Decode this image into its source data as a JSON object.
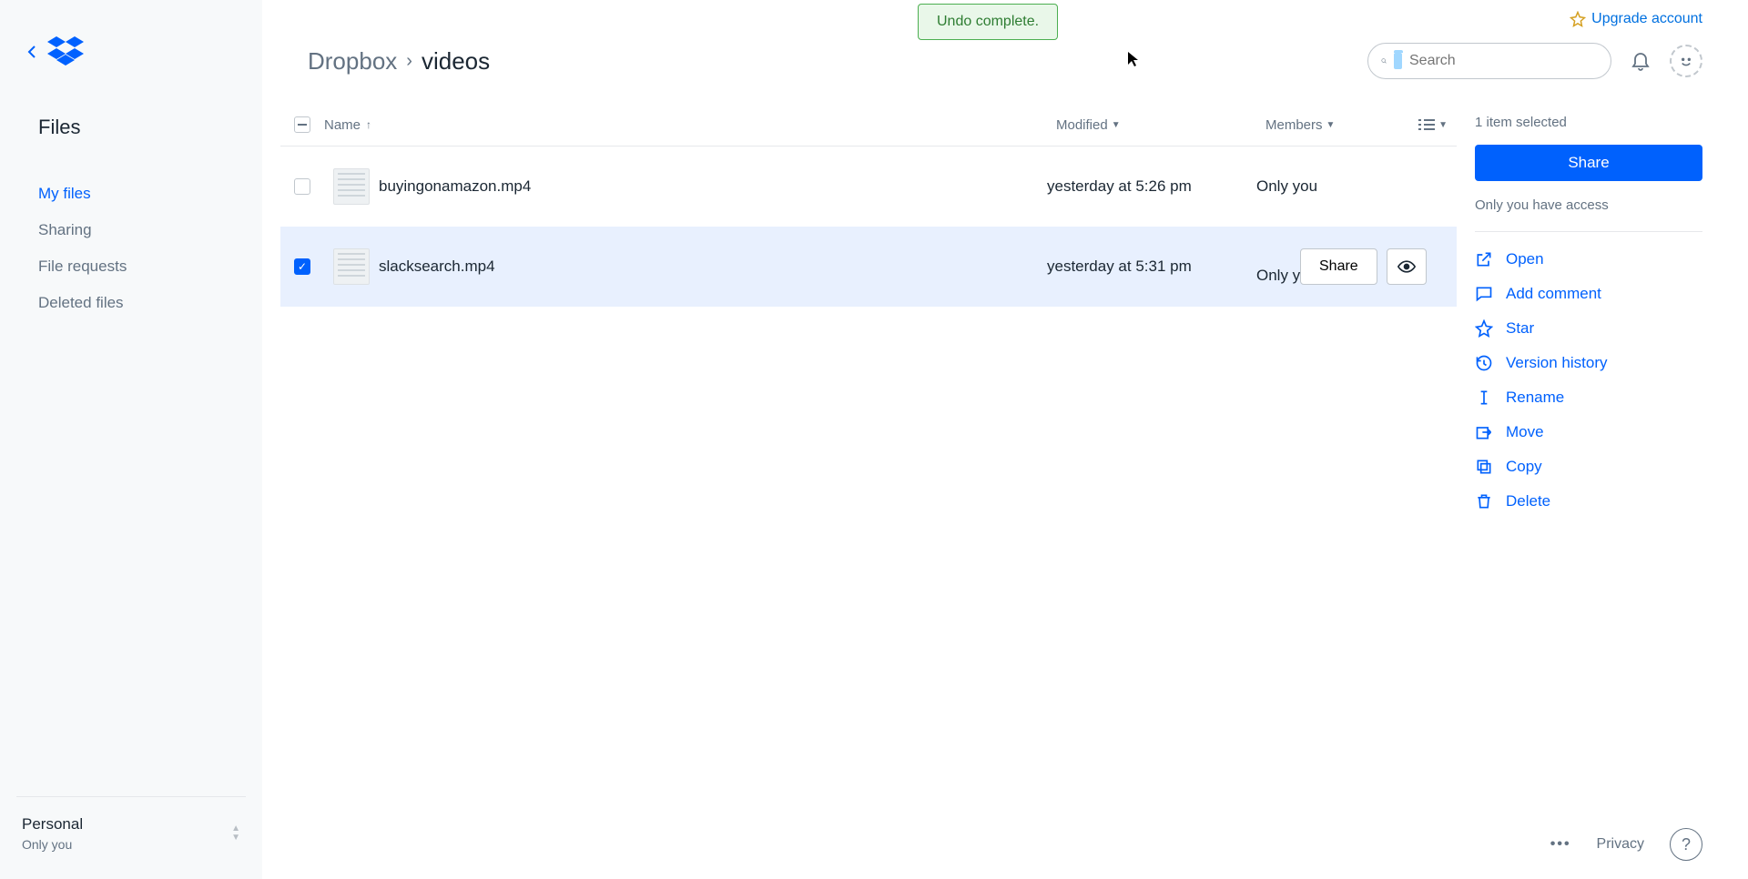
{
  "toast": "Undo complete.",
  "upgrade": {
    "label": "Upgrade account"
  },
  "search": {
    "placeholder": "Search"
  },
  "sidebar": {
    "section": "Files",
    "items": [
      "My files",
      "Sharing",
      "File requests",
      "Deleted files"
    ],
    "active_index": 0,
    "footer": {
      "title": "Personal",
      "sub": "Only you"
    }
  },
  "breadcrumb": {
    "root": "Dropbox",
    "leaf": "videos"
  },
  "columns": {
    "name": "Name",
    "modified": "Modified",
    "members": "Members"
  },
  "files": [
    {
      "name": "buyingonamazon.mp4",
      "modified": "yesterday at 5:26 pm",
      "members": "Only you",
      "selected": false
    },
    {
      "name": "slacksearch.mp4",
      "modified": "yesterday at 5:31 pm",
      "members": "Only you",
      "selected": true
    }
  ],
  "row_actions": {
    "share": "Share"
  },
  "detail": {
    "count": "1 item selected",
    "share": "Share",
    "access": "Only you have access",
    "actions": [
      "Open",
      "Add comment",
      "Star",
      "Version history",
      "Rename",
      "Move",
      "Copy",
      "Delete"
    ]
  },
  "footer": {
    "privacy": "Privacy"
  }
}
